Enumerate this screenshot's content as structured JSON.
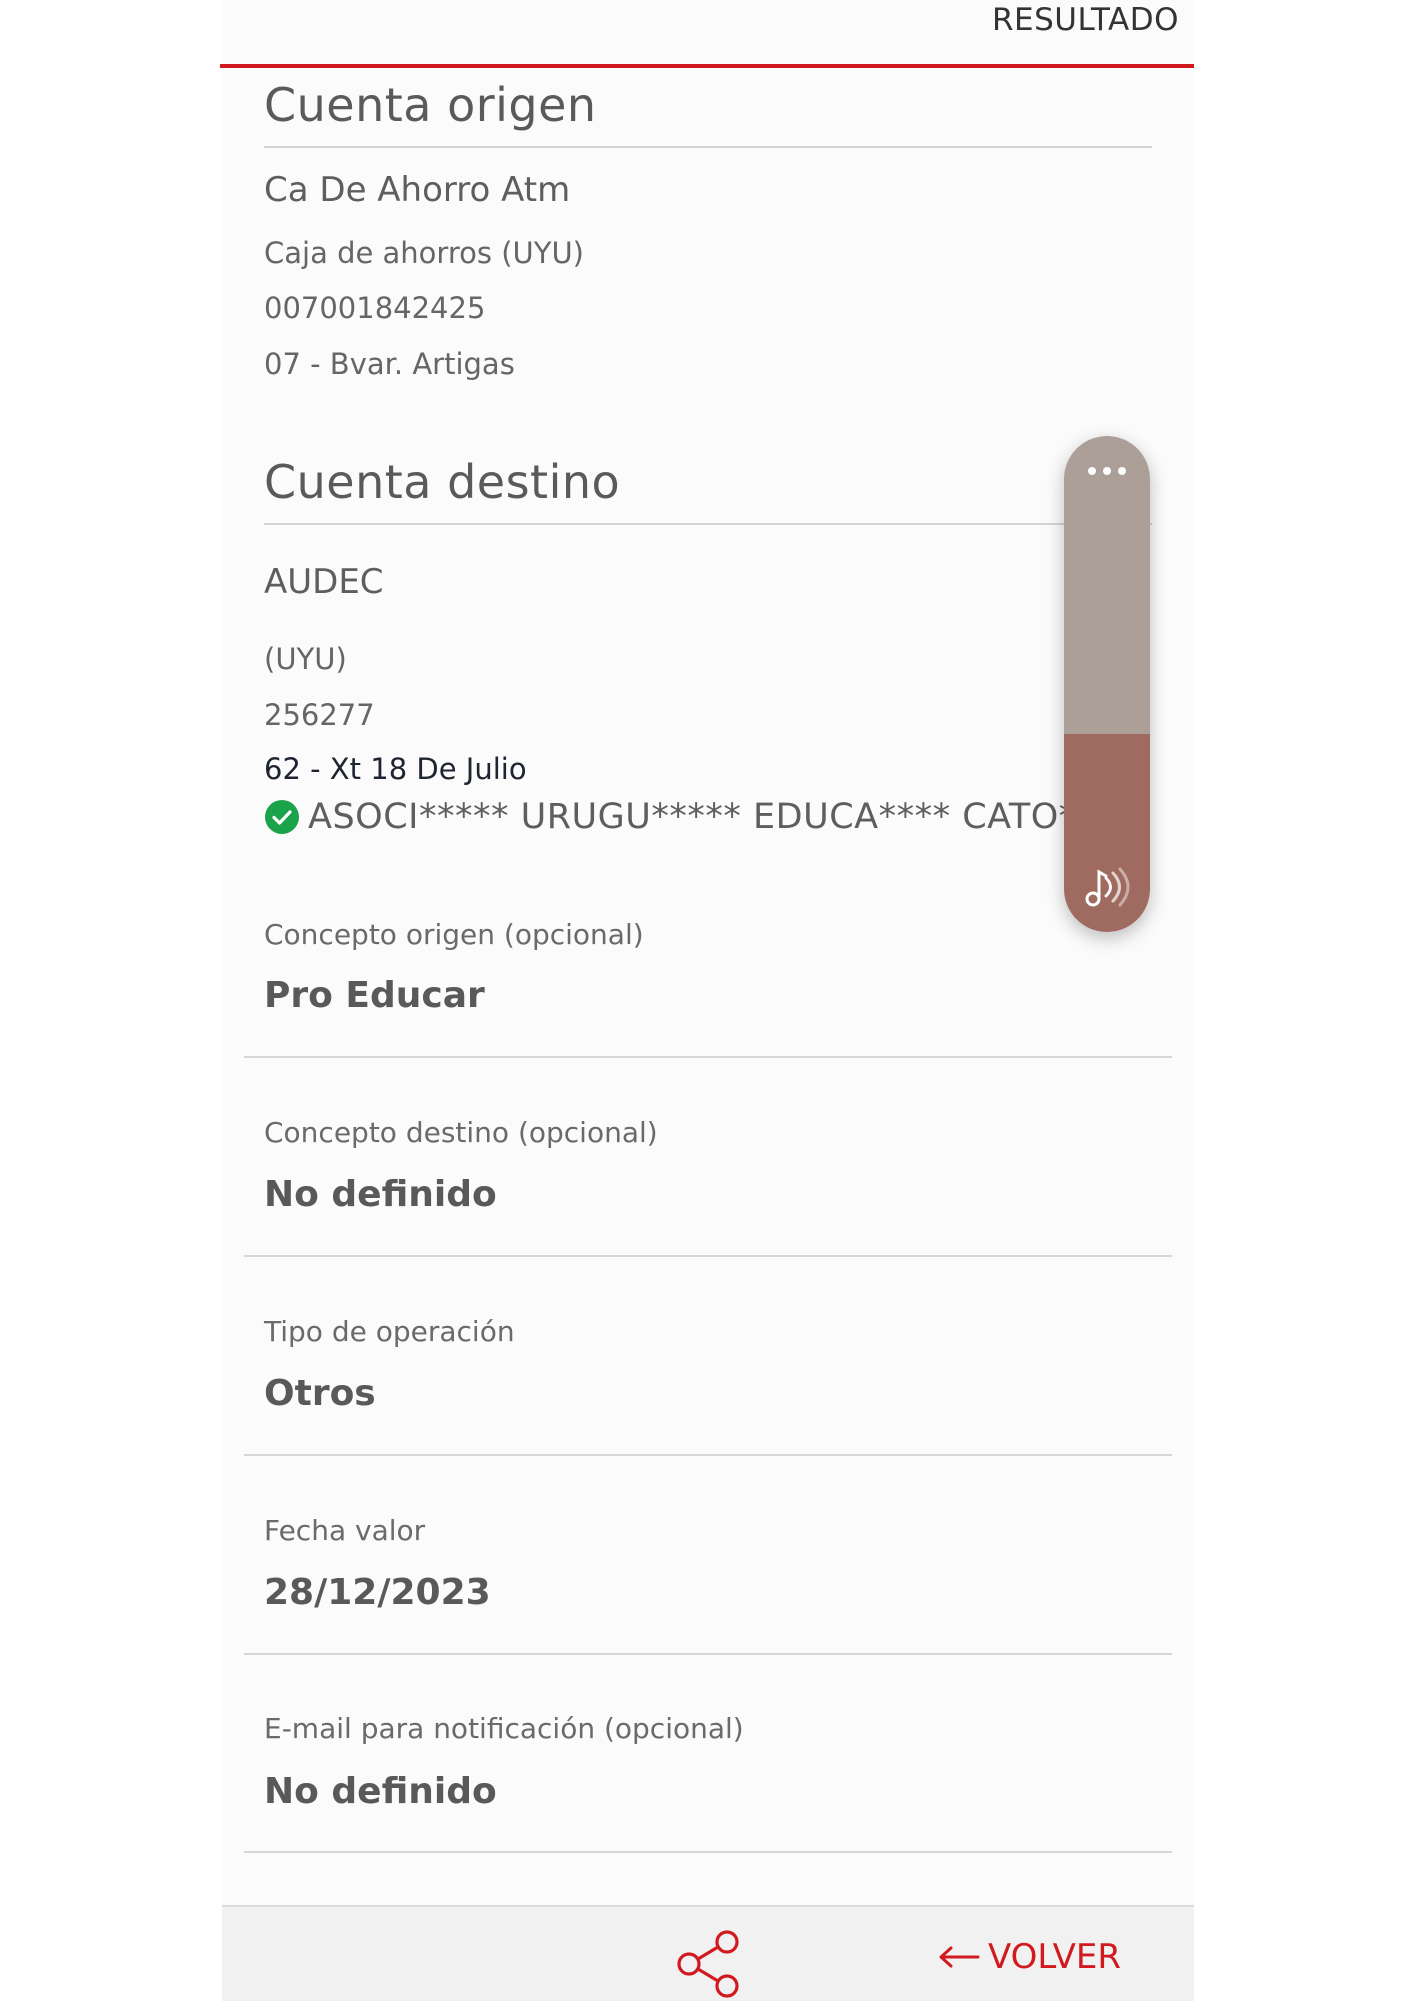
{
  "header": {
    "step": "RESULTADO"
  },
  "origin_account": {
    "heading": "Cuenta origen",
    "name": "Ca De Ahorro Atm",
    "type": "Caja de ahorros (UYU)",
    "number": "007001842425",
    "branch": "07 - Bvar. Artigas"
  },
  "destination_account": {
    "heading": "Cuenta destino",
    "name": "AUDEC",
    "currency": "(UYU)",
    "number": "256277",
    "branch": "62 - Xt 18 De Julio",
    "holder": "ASOCI***** URUGU***** EDUCA**** CATO****"
  },
  "fields": [
    {
      "label": "Concepto origen (opcional)",
      "value": "Pro Educar"
    },
    {
      "label": "Concepto destino (opcional)",
      "value": "No definido"
    },
    {
      "label": "Tipo de operación",
      "value": "Otros"
    },
    {
      "label": "Fecha valor",
      "value": "28/12/2023"
    },
    {
      "label": "E-mail para notificación (opcional)",
      "value": "No definido"
    }
  ],
  "footer": {
    "back_label": "VOLVER"
  },
  "colors": {
    "accent": "#d11a1f",
    "verified": "#1aa34a",
    "widget_top": "#ab9f98",
    "widget_bottom": "#9f6b60"
  },
  "icons": {
    "share": "share-icon",
    "back": "arrow-left-icon",
    "verified": "check-circle-icon",
    "more": "more-dots-icon",
    "sound": "sound-icon"
  }
}
